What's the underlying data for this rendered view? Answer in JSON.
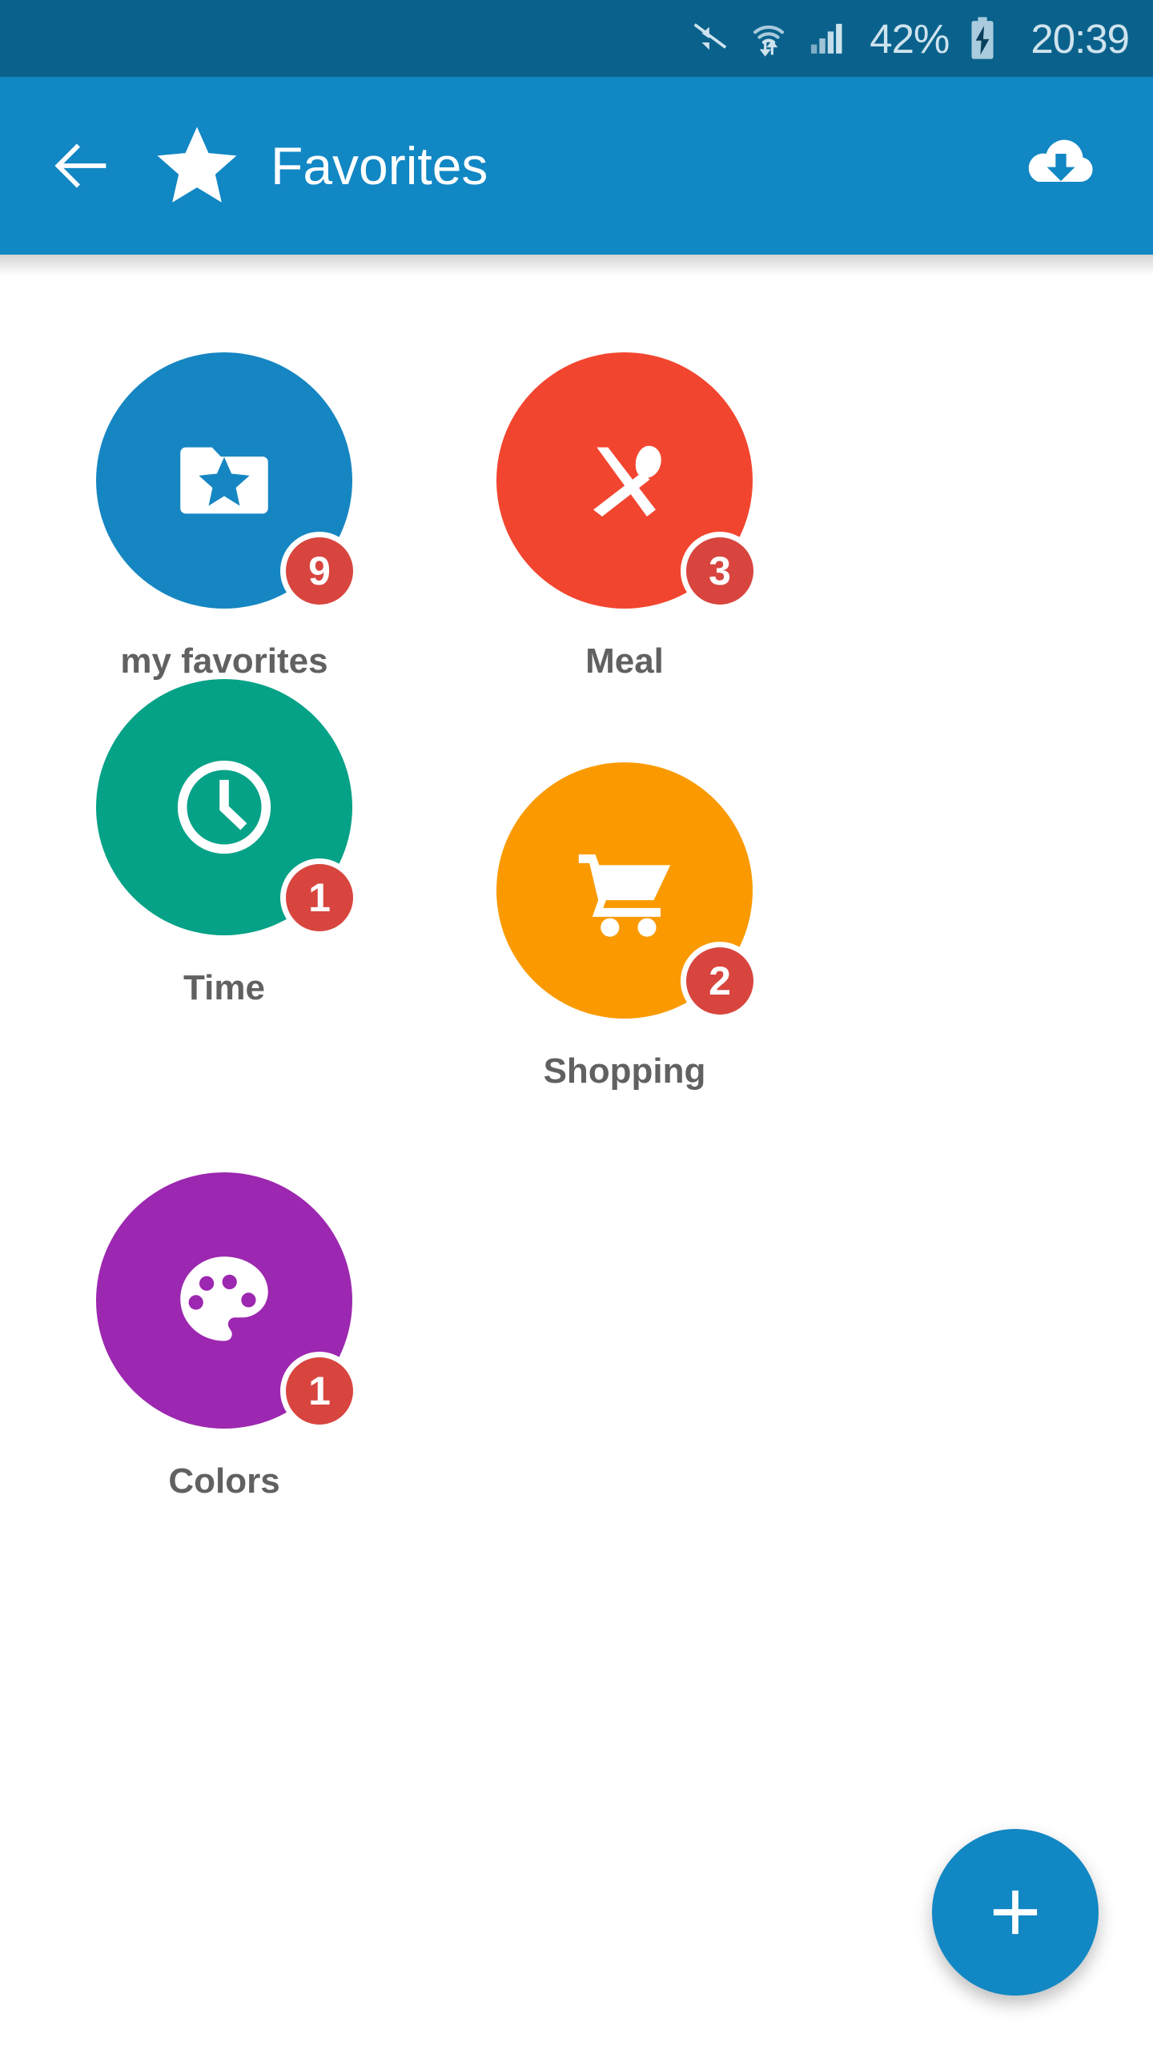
{
  "status_bar": {
    "background": "#0A628C",
    "foreground": "#CFE3EE",
    "mute_icon": "volume-mute-icon",
    "wifi_icon": "wifi-transfer-icon",
    "signal_icon": "cellular-signal-icon",
    "battery_percent": "42%",
    "battery_icon": "battery-charging-icon",
    "clock": "20:39"
  },
  "app_bar": {
    "background": "#1187C4",
    "back_icon": "back-arrow-icon",
    "logo_icon": "star-icon",
    "title": "Favorites",
    "action_icon": "cloud-download-icon"
  },
  "categories": [
    {
      "label": "my favorites",
      "count": "9",
      "color": "#1686C2",
      "icon": "folder-star-icon"
    },
    {
      "label": "Meal",
      "count": "3",
      "color": "#F2452F",
      "icon": "fork-spoon-icon"
    },
    {
      "label": "Time",
      "count": "1",
      "color": "#05A287",
      "icon": "clock-icon"
    },
    {
      "label": "Shopping",
      "count": "2",
      "color": "#FA9A00",
      "icon": "shopping-cart-icon"
    },
    {
      "label": "Colors",
      "count": "1",
      "color": "#9C27B0",
      "icon": "palette-icon"
    }
  ],
  "badge": {
    "color": "#D8453F",
    "ring_color": "#ffffff"
  },
  "fab": {
    "icon": "plus-icon",
    "color": "#1187C4"
  }
}
